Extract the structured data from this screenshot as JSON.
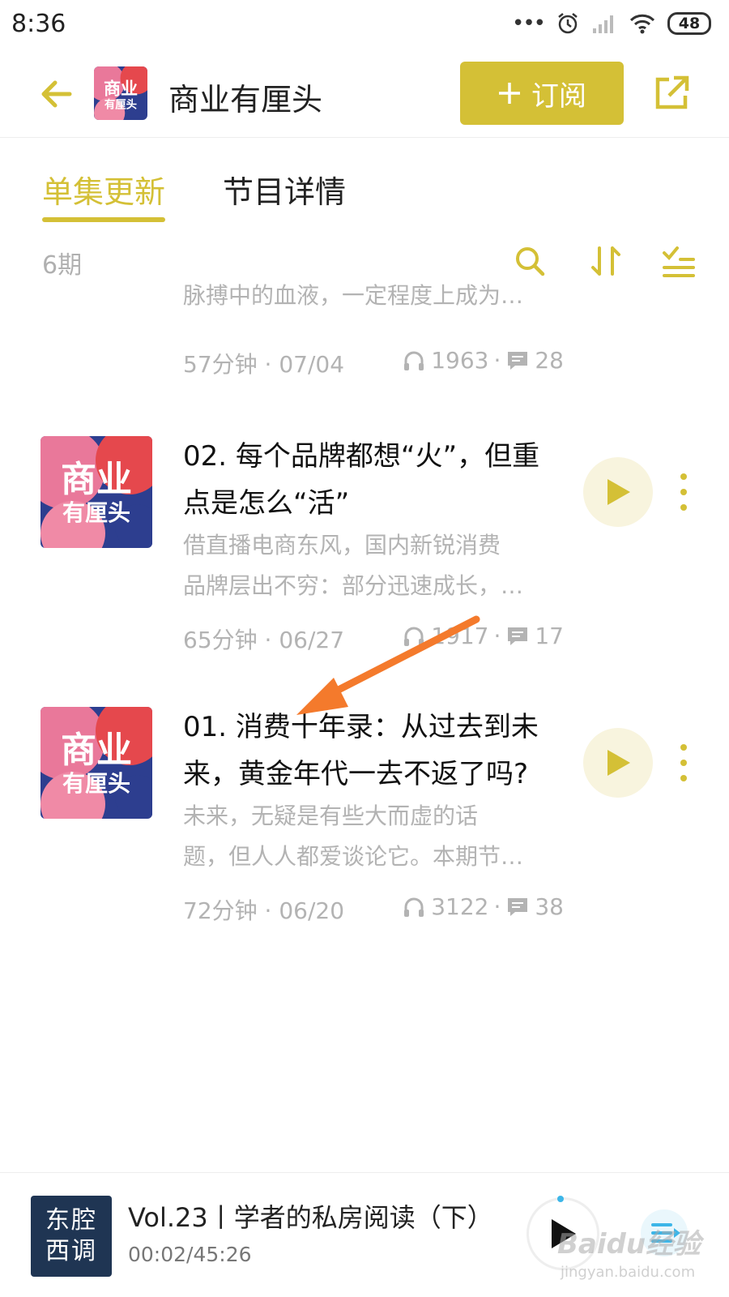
{
  "status_bar": {
    "time": "8:36",
    "battery": "48"
  },
  "header": {
    "title": "商业有厘头",
    "subscribe_label": "订阅"
  },
  "tabs": [
    {
      "label": "单集更新",
      "active": true
    },
    {
      "label": "节目详情",
      "active": false
    }
  ],
  "toolbar": {
    "episode_count": "6期"
  },
  "cover_art": {
    "line1": "商业",
    "line2": "有厘头"
  },
  "episodes": [
    {
      "title": "",
      "desc_line1": "脉搏中的血液，一定程度上成为…",
      "duration_date": "57分钟 · 07/04",
      "plays": "1963",
      "comments": "28"
    },
    {
      "title": "02. 每个品牌都想“火”，但重点是怎么“活”",
      "desc_line1": "借直播电商东风，国内新锐消费",
      "desc_line2": "品牌层出不穷：部分迅速成长，…",
      "duration_date": "65分钟 · 06/27",
      "plays": "1917",
      "comments": "17"
    },
    {
      "title": "01. 消费十年录：从过去到未来，黄金年代一去不返了吗?",
      "desc_line1": "未来，无疑是有些大而虚的话",
      "desc_line2": "题，但人人都爱谈论它。本期节…",
      "duration_date": "72分钟 · 06/20",
      "plays": "3122",
      "comments": "38"
    }
  ],
  "mini_player": {
    "cover_line1": "东腔",
    "cover_line2": "西调",
    "title": "Vol.23丨学者的私房阅读（下）",
    "time": "00:02/45:26"
  },
  "watermark": {
    "main": "Baidu经验",
    "sub": "jingyan.baidu.com"
  },
  "colors": {
    "accent": "#d4c036",
    "accent_light": "#f8f4de",
    "annotation_arrow": "#f47a2c",
    "muted_text": "#b3b3b3"
  }
}
